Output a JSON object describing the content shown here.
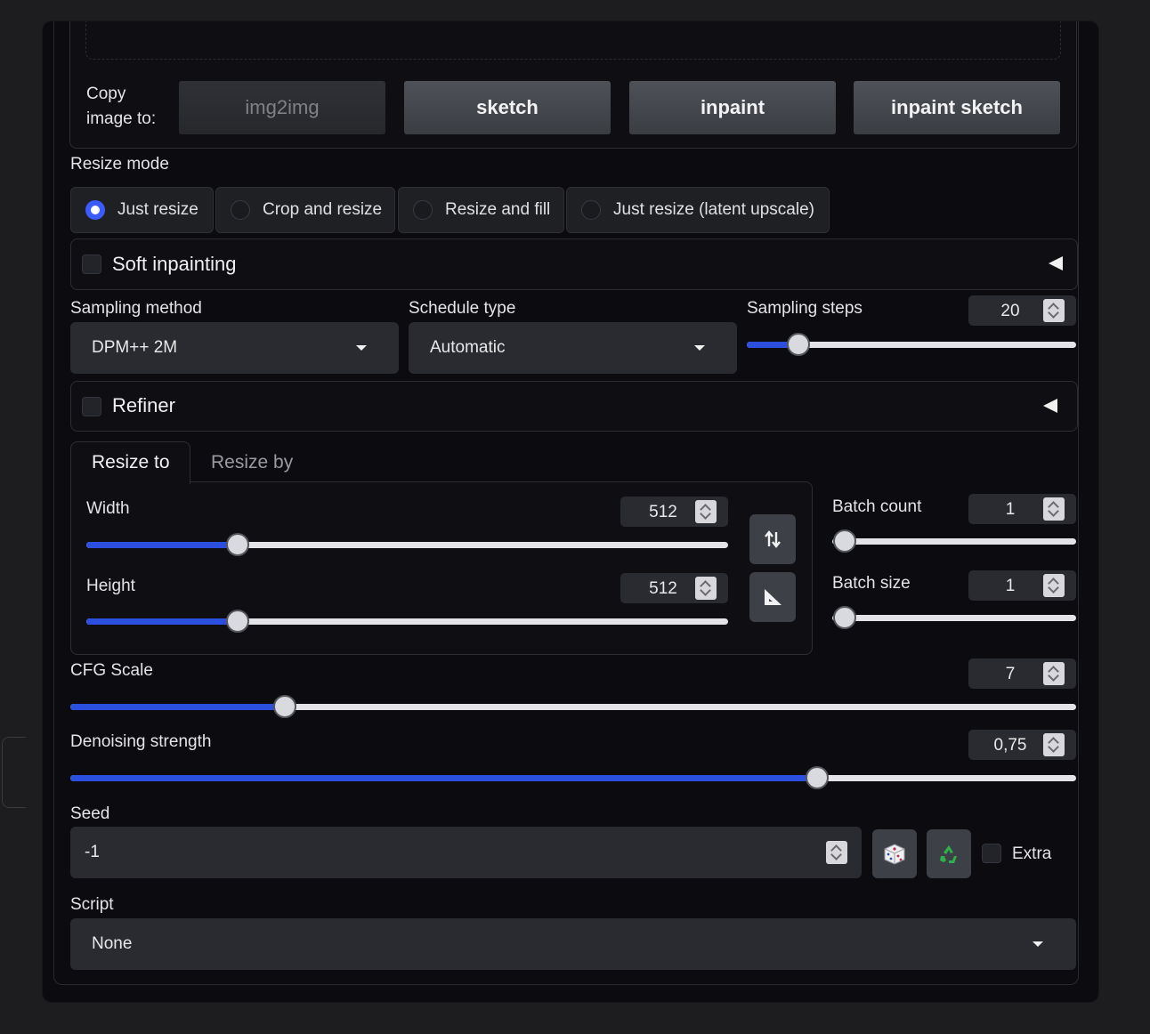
{
  "copy": {
    "label": "Copy\nimage to:",
    "buttons": [
      "img2img",
      "sketch",
      "inpaint",
      "inpaint sketch"
    ]
  },
  "resize_mode": {
    "label": "Resize mode",
    "options": [
      "Just resize",
      "Crop and resize",
      "Resize and fill",
      "Just resize (latent upscale)"
    ],
    "selected": "Just resize"
  },
  "soft_inpainting": {
    "label": "Soft inpainting",
    "checked": false
  },
  "sampling_method": {
    "label": "Sampling method",
    "value": "DPM++ 2M"
  },
  "schedule_type": {
    "label": "Schedule type",
    "value": "Automatic"
  },
  "sampling_steps": {
    "label": "Sampling steps",
    "value": "20",
    "min": 1,
    "max": 150
  },
  "refiner": {
    "label": "Refiner",
    "checked": false
  },
  "size_tabs": {
    "active": "Resize to",
    "other": "Resize by"
  },
  "width": {
    "label": "Width",
    "value": "512",
    "fraction": 0.236
  },
  "height": {
    "label": "Height",
    "value": "512",
    "fraction": 0.236
  },
  "batch_count": {
    "label": "Batch count",
    "value": "1",
    "fraction": 0
  },
  "batch_size": {
    "label": "Batch size",
    "value": "1",
    "fraction": 0
  },
  "cfg_scale": {
    "label": "CFG Scale",
    "value": "7",
    "fraction": 0.214
  },
  "denoising": {
    "label": "Denoising strength",
    "value": "0,75",
    "fraction": 0.75
  },
  "seed": {
    "label": "Seed",
    "value": "-1",
    "extra_label": "Extra"
  },
  "script": {
    "label": "Script",
    "value": "None"
  },
  "colors": {
    "accent": "#2d4fe0",
    "background": "#0c0c10",
    "control": "#2a2b30"
  },
  "icons": [
    "swap-dimensions-icon",
    "aspect-ratio-icon",
    "dice-icon",
    "recycle-icon"
  ]
}
